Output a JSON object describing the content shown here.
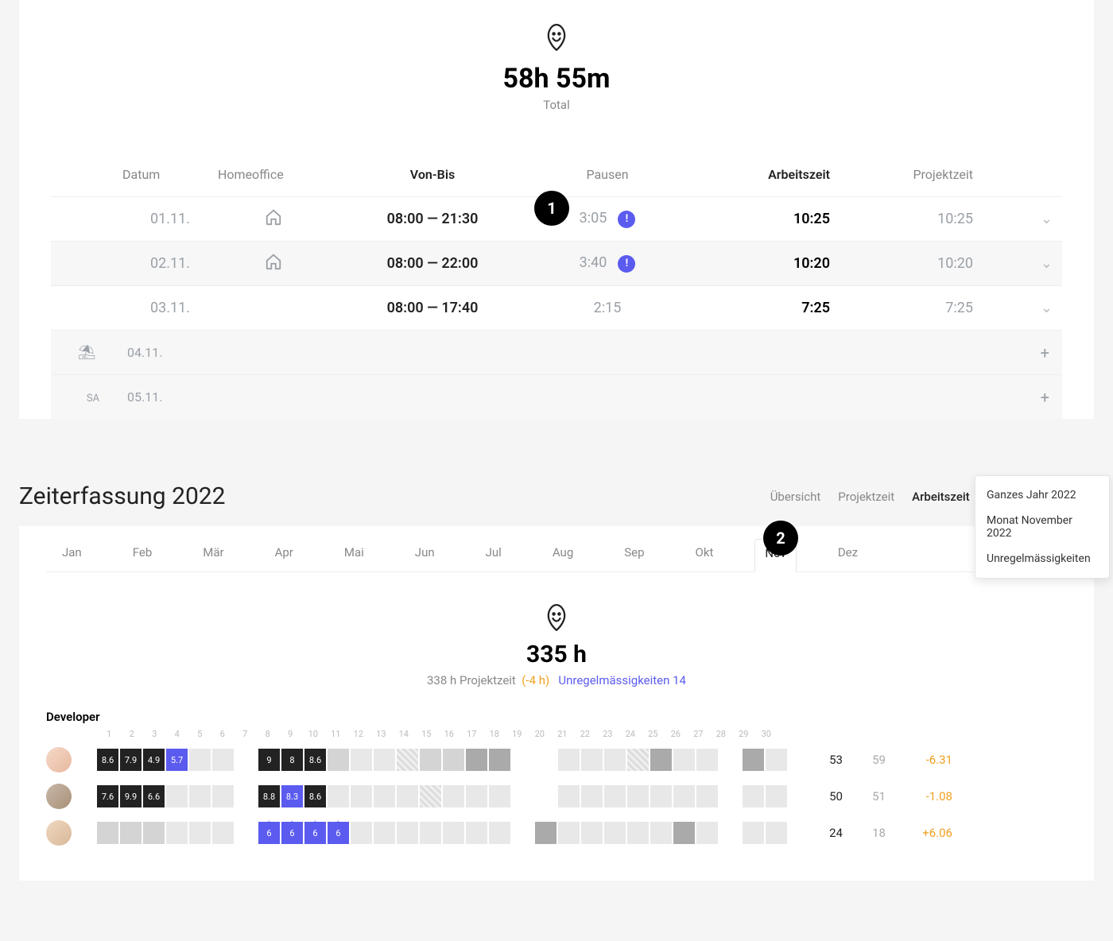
{
  "hero1": {
    "total": "58h 55m",
    "label": "Total"
  },
  "columns": {
    "date": "Datum",
    "home": "Homeoffice",
    "range": "Von-Bis",
    "pause": "Pausen",
    "work": "Arbeitszeit",
    "proj": "Projektzeit"
  },
  "rows": [
    {
      "date": "01.11.",
      "home": true,
      "range": "08:00 — 21:30",
      "pause": "3:05",
      "alert": true,
      "work": "10:25",
      "proj": "10:25"
    },
    {
      "date": "02.11.",
      "home": true,
      "range": "08:00 — 22:00",
      "pause": "3:40",
      "alert": true,
      "work": "10:20",
      "proj": "10:20"
    },
    {
      "date": "03.11.",
      "home": false,
      "range": "08:00 — 17:40",
      "pause": "2:15",
      "alert": false,
      "work": "7:25",
      "proj": "7:25"
    }
  ],
  "empty_rows": [
    {
      "icon": "beach",
      "date": "04.11."
    },
    {
      "icon": "SA",
      "date": "05.11."
    }
  ],
  "step_badges": {
    "b1": "1",
    "b2": "2"
  },
  "sec2": {
    "title": "Zeiterfassung 2022",
    "tabs": {
      "overview": "Übersicht",
      "proj": "Projektzeit",
      "work": "Arbeitszeit"
    },
    "year": "2022"
  },
  "dropdown": {
    "i1": "Ganzes Jahr 2022",
    "i2": "Monat November 2022",
    "i3": "Unregelmässigkeiten"
  },
  "months": [
    "Jan",
    "Feb",
    "Mär",
    "Apr",
    "Mai",
    "Jun",
    "Jul",
    "Aug",
    "Sep",
    "Okt",
    "Nov",
    "Dez"
  ],
  "month_active": "Nov",
  "hero2": {
    "total": "335 h",
    "proj": "338 h Projektzeit",
    "diff": "(-4 h)",
    "irreg": "Unregelmässigkeiten 14"
  },
  "group": "Developer",
  "days": [
    "1",
    "2",
    "3",
    "4",
    "5",
    "6",
    "7",
    "8",
    "9",
    "10",
    "11",
    "12",
    "13",
    "14",
    "15",
    "16",
    "17",
    "18",
    "19",
    "20",
    "21",
    "22",
    "23",
    "24",
    "25",
    "26",
    "27",
    "28",
    "29",
    "30"
  ],
  "people": [
    {
      "cells": [
        {
          "v": "8.6",
          "t": "dark"
        },
        {
          "v": "7.9",
          "t": "dark"
        },
        {
          "v": "4.9",
          "t": "dark"
        },
        {
          "v": "5.7",
          "t": "blue"
        },
        {
          "v": "",
          "t": "lighter"
        },
        {
          "v": "",
          "t": "lighter"
        },
        {
          "v": "",
          "t": "empty"
        },
        {
          "v": "9",
          "t": "dark"
        },
        {
          "v": "8",
          "t": "dark"
        },
        {
          "v": "8.6",
          "t": "dark"
        },
        {
          "v": "",
          "t": "light"
        },
        {
          "v": "",
          "t": "lighter"
        },
        {
          "v": "",
          "t": "lighter"
        },
        {
          "v": "",
          "t": "hatch"
        },
        {
          "v": "",
          "t": "light"
        },
        {
          "v": "",
          "t": "light"
        },
        {
          "v": "",
          "t": "darkgrey"
        },
        {
          "v": "",
          "t": "darkgrey"
        },
        {
          "v": "",
          "t": "empty"
        },
        {
          "v": "",
          "t": "empty"
        },
        {
          "v": "",
          "t": "lighter"
        },
        {
          "v": "",
          "t": "lighter"
        },
        {
          "v": "",
          "t": "lighter"
        },
        {
          "v": "",
          "t": "hatch"
        },
        {
          "v": "",
          "t": "darkgrey"
        },
        {
          "v": "",
          "t": "lighter"
        },
        {
          "v": "",
          "t": "lighter"
        },
        {
          "v": "",
          "t": "empty"
        },
        {
          "v": "",
          "t": "darkgrey"
        },
        {
          "v": "",
          "t": "lighter"
        }
      ],
      "stats": {
        "s1": "53",
        "s2": "59",
        "s3": "-6.31",
        "cls": "neg"
      }
    },
    {
      "cells": [
        {
          "v": "7.6",
          "t": "dark"
        },
        {
          "v": "9.9",
          "t": "dark"
        },
        {
          "v": "6.6",
          "t": "dark"
        },
        {
          "v": "",
          "t": "lighter"
        },
        {
          "v": "",
          "t": "lighter"
        },
        {
          "v": "",
          "t": "lighter"
        },
        {
          "v": "",
          "t": "empty"
        },
        {
          "v": "8.8",
          "t": "dark"
        },
        {
          "v": "8.3",
          "t": "blue"
        },
        {
          "v": "8.6",
          "t": "dark"
        },
        {
          "v": "",
          "t": "lighter"
        },
        {
          "v": "",
          "t": "lighter"
        },
        {
          "v": "",
          "t": "lighter"
        },
        {
          "v": "",
          "t": "lighter"
        },
        {
          "v": "",
          "t": "hatch"
        },
        {
          "v": "",
          "t": "lighter"
        },
        {
          "v": "",
          "t": "lighter"
        },
        {
          "v": "",
          "t": "lighter"
        },
        {
          "v": "",
          "t": "empty"
        },
        {
          "v": "",
          "t": "empty"
        },
        {
          "v": "",
          "t": "lighter"
        },
        {
          "v": "",
          "t": "lighter"
        },
        {
          "v": "",
          "t": "lighter"
        },
        {
          "v": "",
          "t": "lighter"
        },
        {
          "v": "",
          "t": "lighter"
        },
        {
          "v": "",
          "t": "lighter"
        },
        {
          "v": "",
          "t": "lighter"
        },
        {
          "v": "",
          "t": "empty"
        },
        {
          "v": "",
          "t": "lighter"
        },
        {
          "v": "",
          "t": "lighter"
        }
      ],
      "stats": {
        "s1": "50",
        "s2": "51",
        "s3": "-1.08",
        "cls": "neg"
      }
    },
    {
      "cells": [
        {
          "v": "",
          "t": "light"
        },
        {
          "v": "",
          "t": "light"
        },
        {
          "v": "",
          "t": "light"
        },
        {
          "v": "",
          "t": "lighter"
        },
        {
          "v": "",
          "t": "lighter"
        },
        {
          "v": "",
          "t": "lighter"
        },
        {
          "v": "",
          "t": "empty"
        },
        {
          "v": "6",
          "t": "blue",
          "star": true
        },
        {
          "v": "6",
          "t": "blue",
          "star": true
        },
        {
          "v": "6",
          "t": "blue",
          "star": true
        },
        {
          "v": "6",
          "t": "blue",
          "star": true
        },
        {
          "v": "",
          "t": "lighter"
        },
        {
          "v": "",
          "t": "lighter"
        },
        {
          "v": "",
          "t": "lighter"
        },
        {
          "v": "",
          "t": "lighter"
        },
        {
          "v": "",
          "t": "lighter"
        },
        {
          "v": "",
          "t": "lighter"
        },
        {
          "v": "",
          "t": "lighter"
        },
        {
          "v": "",
          "t": "empty"
        },
        {
          "v": "",
          "t": "darkgrey"
        },
        {
          "v": "",
          "t": "lighter"
        },
        {
          "v": "",
          "t": "lighter"
        },
        {
          "v": "",
          "t": "lighter"
        },
        {
          "v": "",
          "t": "lighter"
        },
        {
          "v": "",
          "t": "lighter"
        },
        {
          "v": "",
          "t": "darkgrey"
        },
        {
          "v": "",
          "t": "lighter"
        },
        {
          "v": "",
          "t": "empty"
        },
        {
          "v": "",
          "t": "lighter"
        },
        {
          "v": "",
          "t": "lighter"
        }
      ],
      "stats": {
        "s1": "24",
        "s2": "18",
        "s3": "+6.06",
        "cls": "pos"
      }
    }
  ]
}
